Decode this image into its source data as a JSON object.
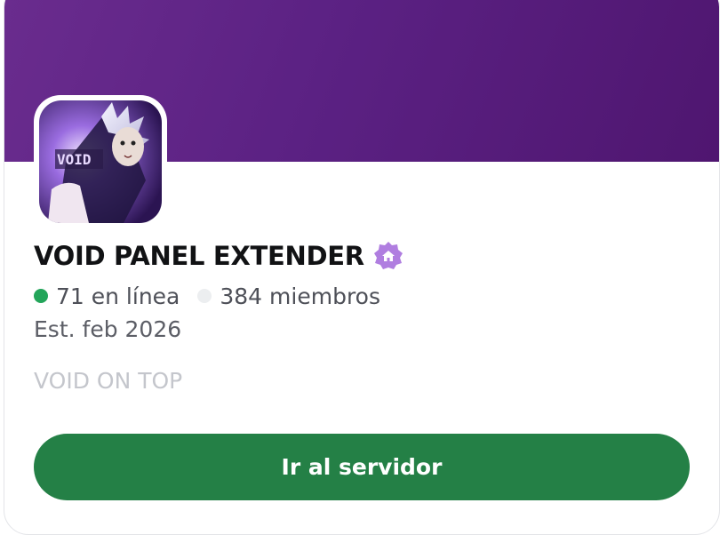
{
  "server": {
    "name": "VOID PANEL EXTENDER",
    "avatar_text": "VOID",
    "badge_icon": "community-home-badge-icon",
    "online_count": "71 en línea",
    "member_count": "384 miembros",
    "established": "Est. feb 2026",
    "description": "VOID ON TOP"
  },
  "actions": {
    "join_label": "Ir al servidor"
  },
  "colors": {
    "banner": "#5b2183",
    "online": "#23a55a",
    "button": "#248046",
    "badge": "#b07ee0"
  }
}
